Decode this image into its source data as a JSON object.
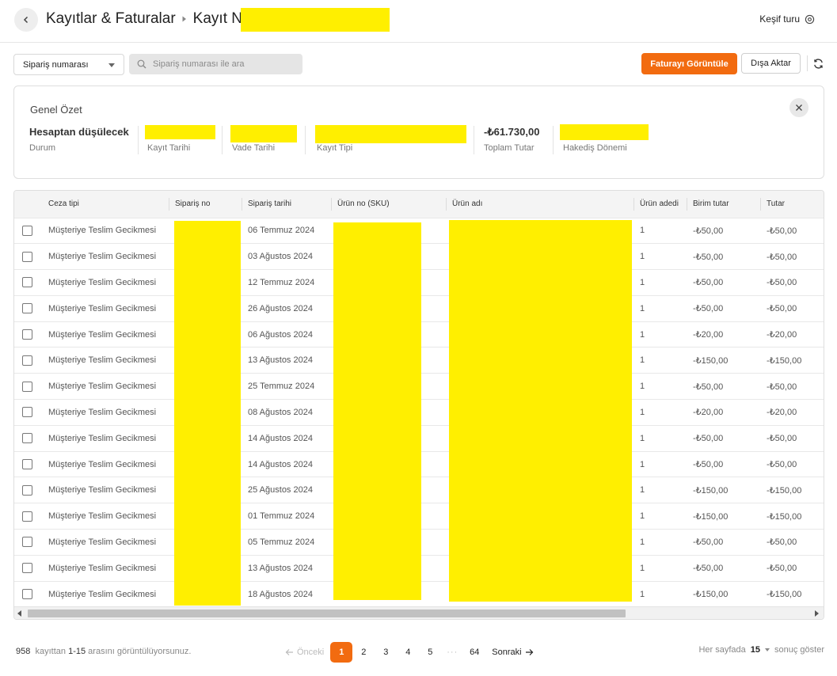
{
  "header": {
    "breadcrumb_parent": "Kayıtlar & Faturalar",
    "record_label": "Kayıt No:",
    "tour_label": "Keşif turu"
  },
  "toolbar": {
    "filter_select_value": "Sipariş numarası",
    "search_placeholder": "Sipariş numarası ile ara",
    "view_invoice_label": "Faturayı Görüntüle",
    "export_label": "Dışa Aktar"
  },
  "summary": {
    "title": "Genel Özet",
    "status_value": "Hesaptan düşülecek",
    "status_label": "Durum",
    "record_date_label": "Kayıt Tarihi",
    "due_date_label": "Vade Tarihi",
    "record_type_label": "Kayıt Tipi",
    "total_value": "-₺61.730,00",
    "total_label": "Toplam Tutar",
    "period_label": "Hakediş Dönemi"
  },
  "table": {
    "columns": [
      "Ceza tipi",
      "Sipariş no",
      "Sipariş tarihi",
      "Ürün no (SKU)",
      "Ürün adı",
      "Ürün adedi",
      "Birim tutar",
      "Tutar"
    ],
    "rows": [
      {
        "type": "Müşteriye Teslim Gecikmesi",
        "date": "06 Temmuz 2024",
        "qty": "1",
        "unit": "-₺50,00",
        "amount": "-₺50,00"
      },
      {
        "type": "Müşteriye Teslim Gecikmesi",
        "date": "03 Ağustos 2024",
        "qty": "1",
        "unit": "-₺50,00",
        "amount": "-₺50,00"
      },
      {
        "type": "Müşteriye Teslim Gecikmesi",
        "date": "12 Temmuz 2024",
        "qty": "1",
        "unit": "-₺50,00",
        "amount": "-₺50,00"
      },
      {
        "type": "Müşteriye Teslim Gecikmesi",
        "date": "26 Ağustos 2024",
        "qty": "1",
        "unit": "-₺50,00",
        "amount": "-₺50,00"
      },
      {
        "type": "Müşteriye Teslim Gecikmesi",
        "date": "06 Ağustos 2024",
        "qty": "1",
        "unit": "-₺20,00",
        "amount": "-₺20,00"
      },
      {
        "type": "Müşteriye Teslim Gecikmesi",
        "date": "13 Ağustos 2024",
        "qty": "1",
        "unit": "-₺150,00",
        "amount": "-₺150,00"
      },
      {
        "type": "Müşteriye Teslim Gecikmesi",
        "date": "25 Temmuz 2024",
        "qty": "1",
        "unit": "-₺50,00",
        "amount": "-₺50,00"
      },
      {
        "type": "Müşteriye Teslim Gecikmesi",
        "date": "08 Ağustos 2024",
        "qty": "1",
        "unit": "-₺20,00",
        "amount": "-₺20,00"
      },
      {
        "type": "Müşteriye Teslim Gecikmesi",
        "date": "14 Ağustos 2024",
        "qty": "1",
        "unit": "-₺50,00",
        "amount": "-₺50,00"
      },
      {
        "type": "Müşteriye Teslim Gecikmesi",
        "date": "14 Ağustos 2024",
        "qty": "1",
        "unit": "-₺50,00",
        "amount": "-₺50,00"
      },
      {
        "type": "Müşteriye Teslim Gecikmesi",
        "date": "25 Ağustos 2024",
        "qty": "1",
        "unit": "-₺150,00",
        "amount": "-₺150,00"
      },
      {
        "type": "Müşteriye Teslim Gecikmesi",
        "date": "01 Temmuz 2024",
        "qty": "1",
        "unit": "-₺150,00",
        "amount": "-₺150,00"
      },
      {
        "type": "Müşteriye Teslim Gecikmesi",
        "date": "05 Temmuz 2024",
        "qty": "1",
        "unit": "-₺50,00",
        "amount": "-₺50,00"
      },
      {
        "type": "Müşteriye Teslim Gecikmesi",
        "date": "13 Ağustos 2024",
        "qty": "1",
        "unit": "-₺50,00",
        "amount": "-₺50,00"
      },
      {
        "type": "Müşteriye Teslim Gecikmesi",
        "date": "18 Ağustos 2024",
        "qty": "1",
        "unit": "-₺150,00",
        "amount": "-₺150,00"
      }
    ]
  },
  "footer": {
    "total_count": "958",
    "text_a": "kayıttan",
    "range": "1-15",
    "text_b": "arasını görüntülüyorsunuz.",
    "prev_label": "Önceki",
    "next_label": "Sonraki",
    "pages": [
      "1",
      "2",
      "3",
      "4",
      "5",
      "···",
      "64"
    ],
    "per_page_prefix": "Her sayfada",
    "per_page_value": "15",
    "per_page_suffix": "sonuç göster"
  },
  "colors": {
    "accent": "#f26b10",
    "redaction": "#ffef00"
  },
  "icons": {
    "back": "chevron-left-icon",
    "tour": "gear-icon",
    "search": "search-icon",
    "refresh": "refresh-icon",
    "close": "close-icon"
  }
}
